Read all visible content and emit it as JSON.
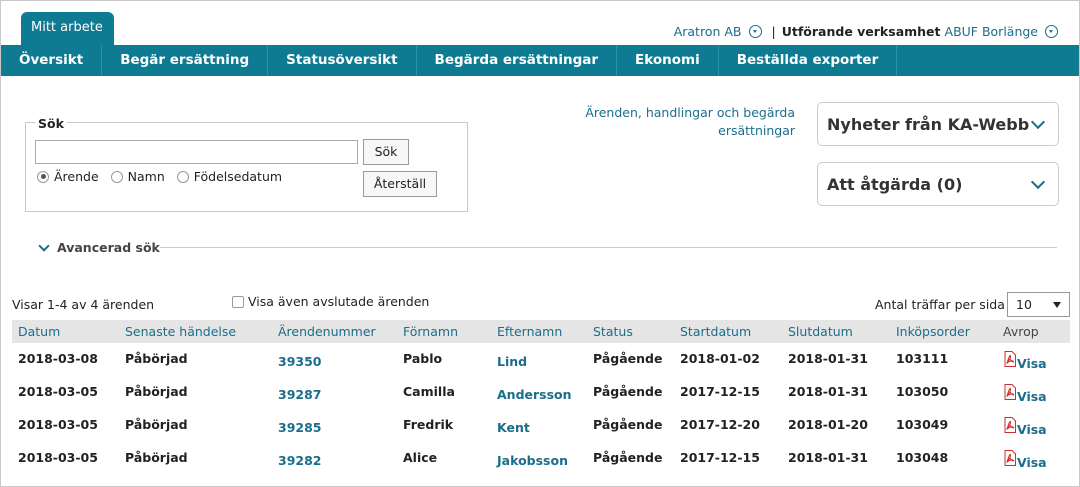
{
  "top_tab": "Mitt arbete",
  "org": {
    "name": "Aratron AB",
    "separator": "|",
    "label": "Utförande verksamhet",
    "unit": "ABUF Borlänge"
  },
  "nav": [
    "Översikt",
    "Begär ersättning",
    "Statusöversikt",
    "Begärda ersättningar",
    "Ekonomi",
    "Beställda exporter"
  ],
  "search": {
    "legend": "Sök",
    "input_value": "",
    "search_button": "Sök",
    "reset_button": "Återställ",
    "radios": [
      "Ärende",
      "Namn",
      "Födelsedatum"
    ]
  },
  "info_link": "Ärenden, handlingar och begärda ersättningar",
  "panels": {
    "news": "Nyheter från KA-Webb",
    "actions": "Att åtgärda (0)"
  },
  "advanced_search": "Avancerad sök",
  "showing": "Visar 1-4 av 4 ärenden",
  "show_closed": "Visa även avslutade ärenden",
  "per_page_label": "Antal träffar per sida",
  "per_page_value": "10",
  "table": {
    "headers": [
      "Datum",
      "Senaste händelse",
      "Ärendenummer",
      "Förnamn",
      "Efternamn",
      "Status",
      "Startdatum",
      "Slutdatum",
      "Inköpsorder",
      "Avrop"
    ],
    "rows": [
      [
        "2018-03-08",
        "Påbörjad",
        "39350",
        "Pablo",
        "Lind",
        "Pågående",
        "2018-01-02",
        "2018-01-31",
        "103111",
        "Visa"
      ],
      [
        "2018-03-05",
        "Påbörjad",
        "39287",
        "Camilla",
        "Andersson",
        "Pågående",
        "2017-12-15",
        "2018-01-31",
        "103050",
        "Visa"
      ],
      [
        "2018-03-05",
        "Påbörjad",
        "39285",
        "Fredrik",
        "Kent",
        "Pågående",
        "2017-12-20",
        "2018-01-20",
        "103049",
        "Visa"
      ],
      [
        "2018-03-05",
        "Påbörjad",
        "39282",
        "Alice",
        "Jakobsson",
        "Pågående",
        "2017-12-15",
        "2018-01-31",
        "103048",
        "Visa"
      ]
    ]
  },
  "colors": {
    "brand": "#0f7b93",
    "link": "#1b6d8c"
  }
}
